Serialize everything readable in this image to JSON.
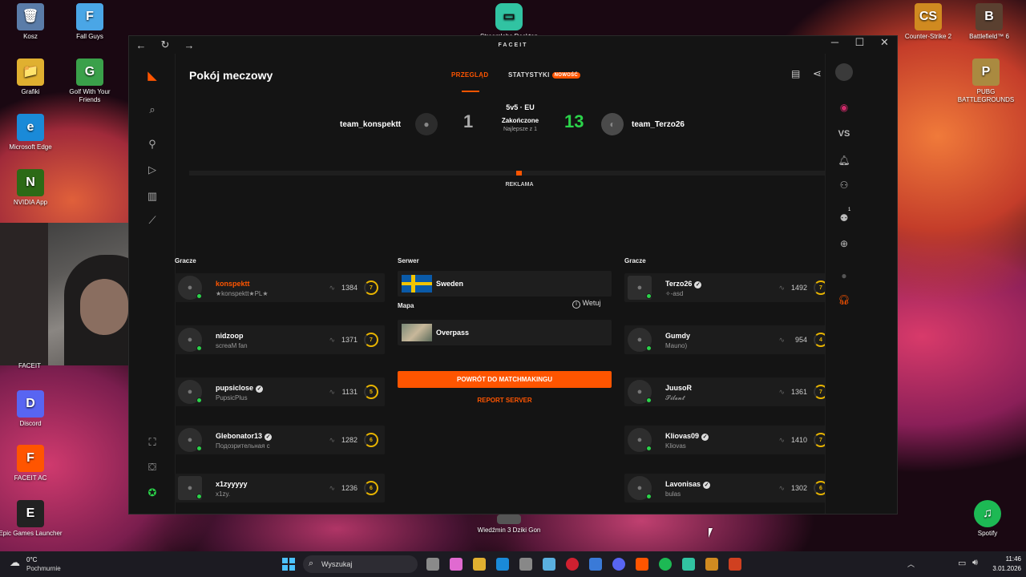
{
  "desktop": {
    "left_icons": [
      {
        "label": "Kosz",
        "color": "#5a7ca8",
        "glyph": "🗑"
      },
      {
        "label": "Fall Guys",
        "color": "#4aa6e6",
        "glyph": "F"
      },
      {
        "label": "Grafiki",
        "color": "#e0b030",
        "glyph": "📁"
      },
      {
        "label": "Golf With Your Friends",
        "color": "#3aa04a",
        "glyph": "G"
      },
      {
        "label": "Microsoft Edge",
        "color": "#1a8ad8",
        "glyph": "e"
      },
      {
        "label": "NVIDIA App",
        "color": "#2c6a16",
        "glyph": "N"
      },
      {
        "label": "Discord",
        "color": "#5865f2",
        "glyph": "D"
      },
      {
        "label": "FACEIT AC",
        "color": "#ff5500",
        "glyph": "F"
      },
      {
        "label": "Epic Games Launcher",
        "color": "#222",
        "glyph": "E"
      }
    ],
    "right_icons": [
      {
        "label": "Counter-Strike 2",
        "color": "#d08a20",
        "glyph": "CS"
      },
      {
        "label": "Battlefield™ 6",
        "color": "#5a4030",
        "glyph": "B"
      },
      {
        "label": "PUBG BATTLEGROUNDS",
        "color": "#aa8a40",
        "glyph": "P"
      },
      {
        "label": "Spotify",
        "color": "#1db954",
        "glyph": "♫"
      }
    ],
    "top_icon": "Streamlabs Desktop",
    "bottom_icon": "Wiedźmin 3 Dziki Gon",
    "webcam_label": "FACEIT"
  },
  "window": {
    "title": "FACEIT"
  },
  "page": {
    "title": "Pokój meczowy",
    "tabs": [
      {
        "label": "PRZEGLĄD"
      },
      {
        "label": "STATYSTYKI",
        "badge": "NOWOŚĆ"
      }
    ]
  },
  "match": {
    "mode": "5v5 · EU",
    "status": "Zakończone",
    "format": "Najlepsze z 1",
    "team1": {
      "name": "team_konspektt",
      "score": "1"
    },
    "team2": {
      "name": "team_Terzo26",
      "score": "13"
    },
    "ad_label": "REKLAMA"
  },
  "players_label": "Gracze",
  "team1_players": [
    {
      "name": "konspektt",
      "tag": "★konspektt★PL★",
      "elo": "1384",
      "level": "7"
    },
    {
      "name": "nidzoop",
      "tag": "screaM fan",
      "elo": "1371",
      "level": "7"
    },
    {
      "name": "pupsiclose",
      "tag": "PupsicPlus",
      "elo": "1131",
      "level": "5"
    },
    {
      "name": "Glebonator13",
      "tag": "Подозрительная с",
      "elo": "1282",
      "level": "6"
    },
    {
      "name": "x1zyyyyy",
      "tag": "x1zy.",
      "elo": "1236",
      "level": "6"
    }
  ],
  "team2_players": [
    {
      "name": "Terzo26",
      "tag": "✧-asd",
      "elo": "1492",
      "level": "7"
    },
    {
      "name": "Gumdy",
      "tag": "Mauno)",
      "elo": "954",
      "level": "4"
    },
    {
      "name": "JuusoR",
      "tag": "𝓢𝓲𝓵𝓮𝓷𝓽",
      "elo": "1361",
      "level": "7"
    },
    {
      "name": "Kliovas09",
      "tag": "Kliovas",
      "elo": "1410",
      "level": "7"
    },
    {
      "name": "Lavonisas",
      "tag": "bulas",
      "elo": "1302",
      "level": "6"
    }
  ],
  "server": {
    "label": "Serwer",
    "name": "Sweden",
    "map_label": "Mapa",
    "map_name": "Overpass",
    "info_label": "Wetuj"
  },
  "actions": {
    "matchmaking": "POWRÓT DO MATCHMAKINGU",
    "report": "REPORT SERVER"
  },
  "rnav": {
    "vs": "VS",
    "badge": "1"
  },
  "taskbar": {
    "weather_temp": "0°C",
    "weather_text": "Pochmurnie",
    "search_placeholder": "Wyszukaj",
    "time": "11:46",
    "date": "3.01.2026"
  },
  "colors": {
    "accent": "#ff5500",
    "team2_score": "#2bd34a",
    "level": "#e8b400"
  }
}
